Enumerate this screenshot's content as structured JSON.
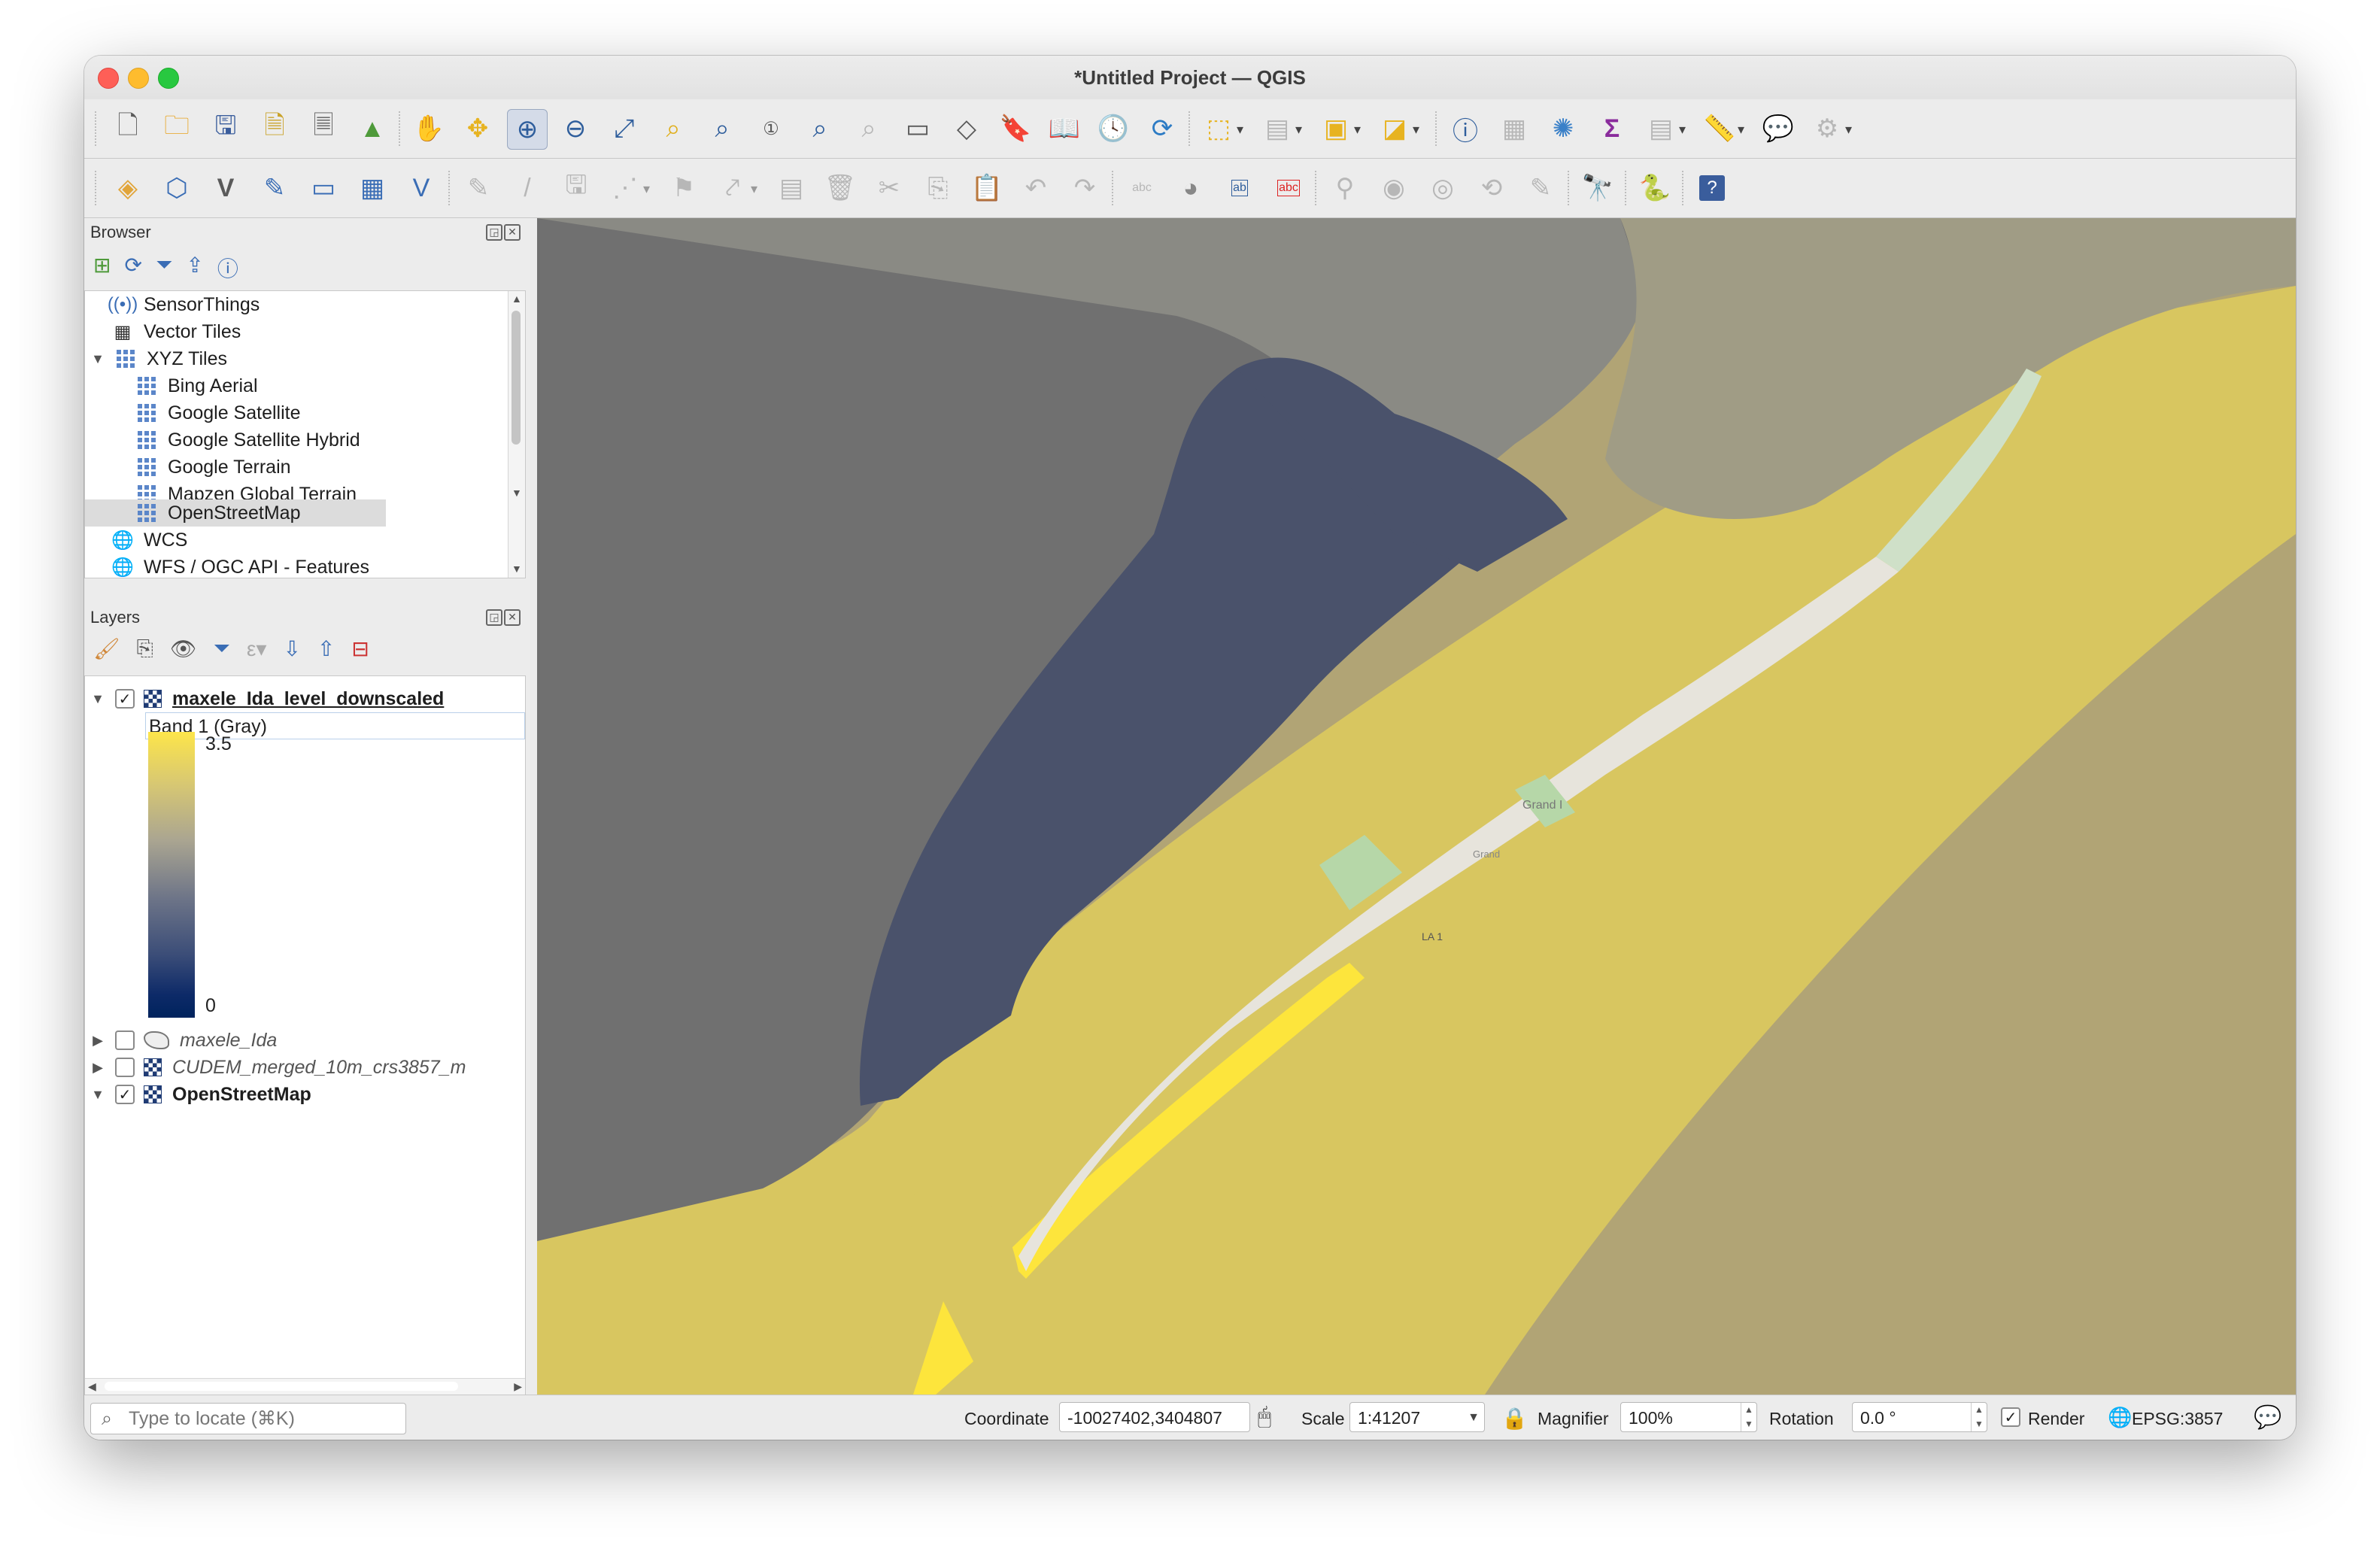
{
  "window": {
    "title": "*Untitled Project — QGIS"
  },
  "toolbar1": {
    "icons": [
      "new-project-icon",
      "open-project-icon",
      "save-project-icon",
      "save-as-icon",
      "print-layout-icon",
      "style-manager-icon",
      "pan-icon",
      "pan-to-selection-icon",
      "zoom-in-icon",
      "zoom-out-icon",
      "zoom-full-icon",
      "zoom-to-selection-icon",
      "zoom-to-layer-icon",
      "zoom-native-icon",
      "zoom-last-icon",
      "zoom-next-icon",
      "new-map-view-icon",
      "new-3d-view-icon",
      "bookmark-icon",
      "show-bookmarks-icon",
      "temporal-controller-icon",
      "refresh-icon",
      "select-feature-icon",
      "deselect-icon",
      "select-by-expression-icon",
      "select-by-location-icon",
      "identify-icon",
      "attribute-table-icon",
      "settings-gear-icon",
      "sum-statistics-icon",
      "field-calc-icon",
      "measure-icon",
      "map-tips-icon",
      "annotation-icon"
    ]
  },
  "toolbar2": {
    "icons": [
      "add-vector-icon",
      "add-raster-icon",
      "add-delimited-icon",
      "add-mesh-icon",
      "add-wms-icon",
      "add-wcs-icon",
      "add-wfs-icon",
      "digitize-icon",
      "edit-pencil-icon",
      "save-edits-icon",
      "add-feature-icon",
      "vertex-tool-icon",
      "modify-attributes-icon",
      "delete-icon",
      "cut-icon",
      "copy-icon",
      "paste-icon",
      "undo-icon",
      "redo-icon",
      "label-tool-icon",
      "diagram-icon",
      "label-pin-icon",
      "label-highlight-icon",
      "pin-label-icon",
      "show-label-icon",
      "move-label-icon",
      "rotate-label-icon",
      "change-label-icon",
      "osm-plugin-icon",
      "python-icon",
      "help-icon"
    ]
  },
  "browser": {
    "title": "Browser",
    "items": [
      {
        "label": "SensorThings",
        "icon": "sensorthings-icon",
        "indent": 0
      },
      {
        "label": "Vector Tiles",
        "icon": "vector-tiles-icon",
        "indent": 0
      },
      {
        "label": "XYZ Tiles",
        "icon": "xyz-tiles-icon",
        "indent": 0,
        "expanded": true
      },
      {
        "label": "Bing Aerial",
        "icon": "tile-icon",
        "indent": 1
      },
      {
        "label": "Google Satellite",
        "icon": "tile-icon",
        "indent": 1
      },
      {
        "label": "Google Satellite Hybrid",
        "icon": "tile-icon",
        "indent": 1
      },
      {
        "label": "Google Terrain",
        "icon": "tile-icon",
        "indent": 1
      },
      {
        "label": "Mapzen Global Terrain",
        "icon": "tile-icon",
        "indent": 1
      },
      {
        "label": "OpenStreetMap",
        "icon": "tile-icon",
        "indent": 1,
        "selected": true
      },
      {
        "label": "WCS",
        "icon": "wcs-icon",
        "indent": 0
      },
      {
        "label": "WFS / OGC API - Features",
        "icon": "wfs-icon",
        "indent": 0
      }
    ]
  },
  "layers": {
    "title": "Layers",
    "items": [
      {
        "label": "maxele_Ida_level_downscaled",
        "checked": true,
        "expanded": true,
        "bold": true,
        "underline": true
      },
      {
        "label": "maxele_Ida",
        "checked": false,
        "expanded": false,
        "italic": true
      },
      {
        "label": "CUDEM_merged_10m_crs3857_m",
        "checked": false,
        "expanded": false,
        "italic": true
      },
      {
        "label": "OpenStreetMap",
        "checked": true,
        "expanded": true,
        "bold": true
      }
    ],
    "band_label": "Band 1 (Gray)",
    "legend_max": "3.5",
    "legend_min": "0"
  },
  "map": {
    "labels": [
      "Grand I",
      "LA 1",
      "Grand"
    ]
  },
  "status": {
    "locator_placeholder": "Type to locate (⌘K)",
    "coordinate_label": "Coordinate",
    "coordinate_value": "-10027402,3404807",
    "scale_label": "Scale",
    "scale_value": "1:41207",
    "magnifier_label": "Magnifier",
    "magnifier_value": "100%",
    "rotation_label": "Rotation",
    "rotation_value": "0.0 °",
    "render_label": "Render",
    "render_checked": true,
    "crs_label": "EPSG:3857"
  }
}
